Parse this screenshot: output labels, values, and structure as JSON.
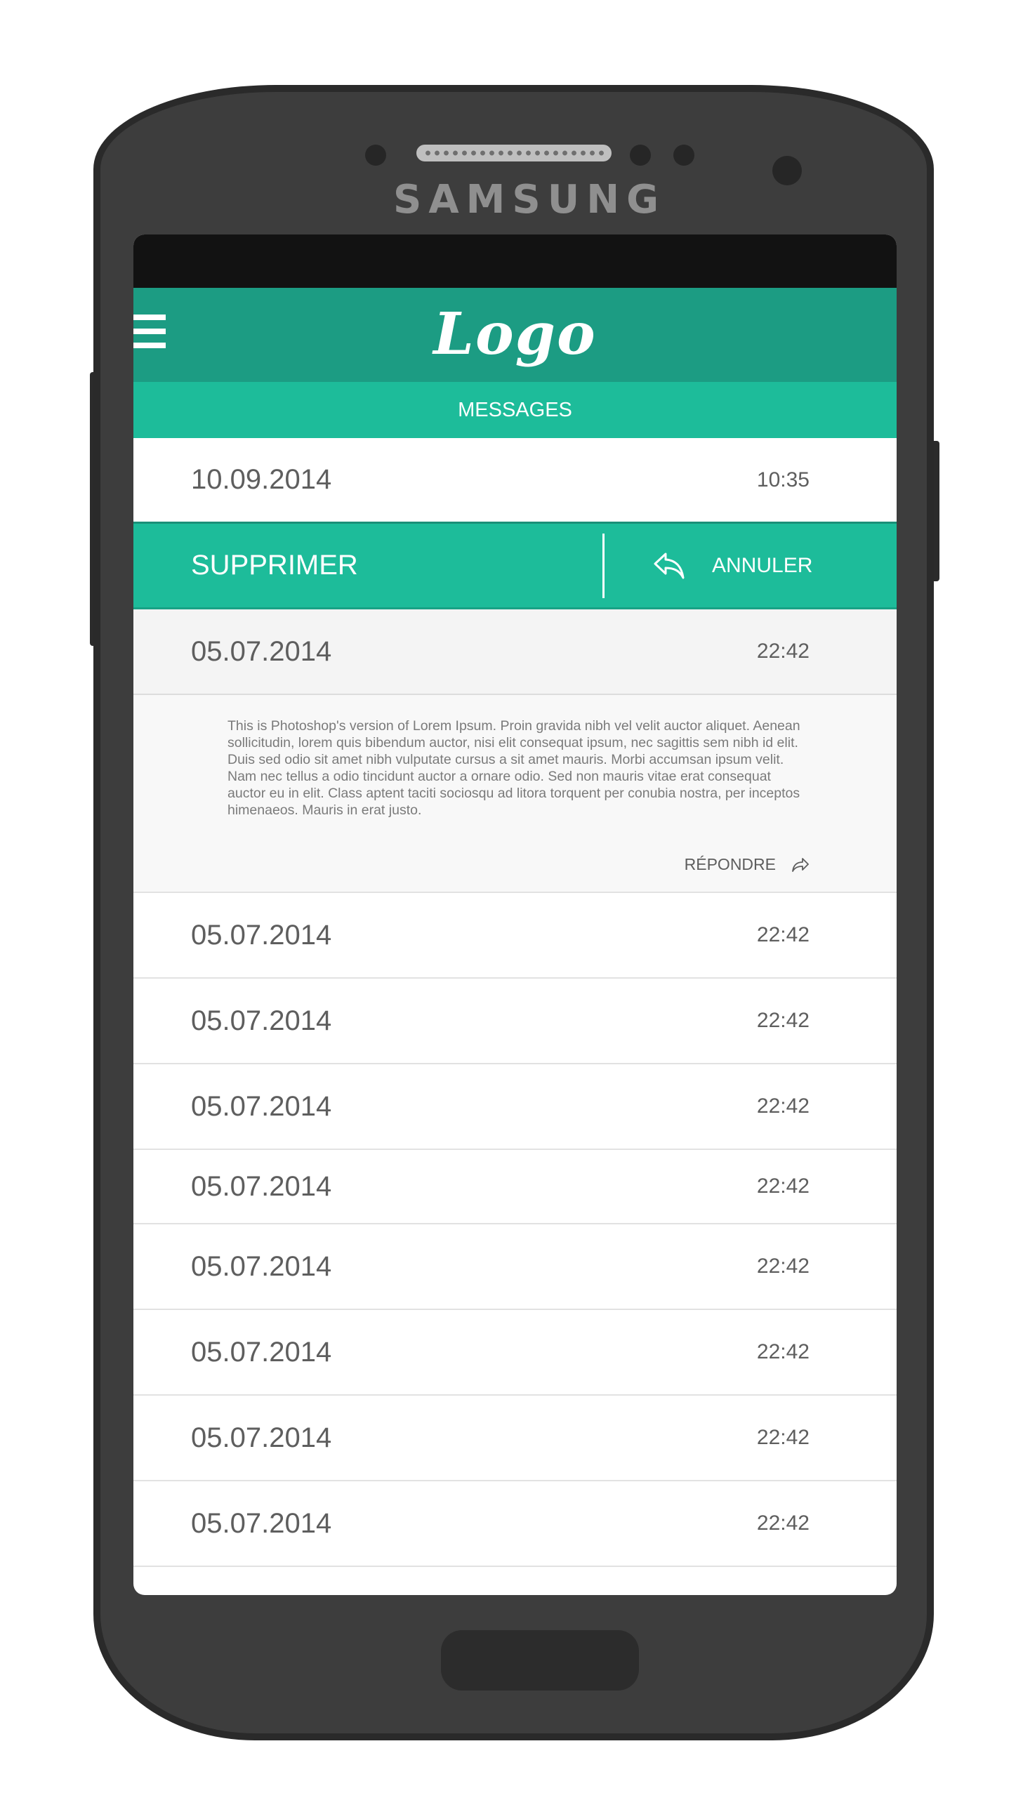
{
  "device": {
    "brand": "SAMSUNG"
  },
  "header": {
    "logo": "Logo",
    "menu_icon": "hamburger-menu-icon"
  },
  "subheader": {
    "title": "MESSAGES"
  },
  "first_message": {
    "date": "10.09.2014",
    "time": "10:35"
  },
  "action_bar": {
    "delete_label": "SUPPRIMER",
    "cancel_label": "ANNULER",
    "cancel_icon": "reply-arrow-icon"
  },
  "selected_message": {
    "date": "05.07.2014",
    "time": "22:42",
    "body": "This is Photoshop's version  of Lorem Ipsum. Proin gravida nibh vel velit auctor aliquet. Aenean sollicitudin, lorem quis bibendum auctor, nisi elit consequat ipsum, nec sagittis sem nibh id elit. Duis sed odio sit amet nibh vulputate cursus a sit amet mauris. Morbi accumsan ipsum velit. Nam nec tellus a odio tincidunt auctor a ornare odio. Sed non  mauris vitae erat consequat auctor eu in elit. Class aptent taciti sociosqu ad litora torquent per conubia nostra, per inceptos himenaeos. Mauris in erat justo.",
    "reply_label": "RÉPONDRE",
    "reply_icon": "forward-arrow-icon"
  },
  "messages": [
    {
      "date": "05.07.2014",
      "time": "22:42"
    },
    {
      "date": "05.07.2014",
      "time": "22:42"
    },
    {
      "date": "05.07.2014",
      "time": "22:42"
    },
    {
      "date": "05.07.2014",
      "time": "22:42"
    },
    {
      "date": "05.07.2014",
      "time": "22:42"
    },
    {
      "date": "05.07.2014",
      "time": "22:42"
    },
    {
      "date": "05.07.2014",
      "time": "22:42"
    },
    {
      "date": "05.07.2014",
      "time": "22:42"
    }
  ],
  "colors": {
    "header": "#1c9c83",
    "accent": "#1dbc9a",
    "text": "#5e5e5e",
    "phone_body": "#3d3d3d"
  }
}
